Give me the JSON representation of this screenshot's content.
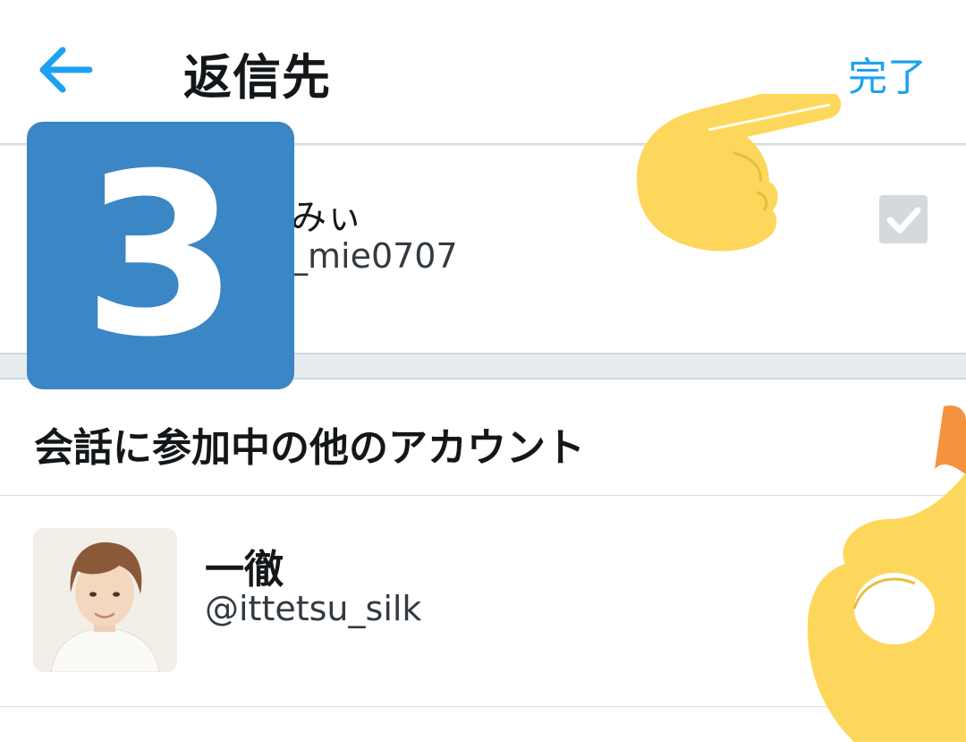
{
  "header": {
    "title": "返信先",
    "done_label": "完了"
  },
  "selected_user": {
    "name": "みぃ",
    "handle": "_mie0707",
    "checked": true
  },
  "section": {
    "title": "会話に参加中の他のアカウント"
  },
  "other_users": [
    {
      "name": "一徹",
      "handle": "@ittetsu_silk",
      "checked": false
    }
  ],
  "overlay": {
    "step_number": "3",
    "pointing_hand_emoji": "pointing-right-hand-icon",
    "ok_hand_emoji": "ok-hand-icon"
  },
  "colors": {
    "accent": "#1da1f2",
    "step_badge": "#3b86c4",
    "emoji_yellow": "#fdd75b"
  }
}
